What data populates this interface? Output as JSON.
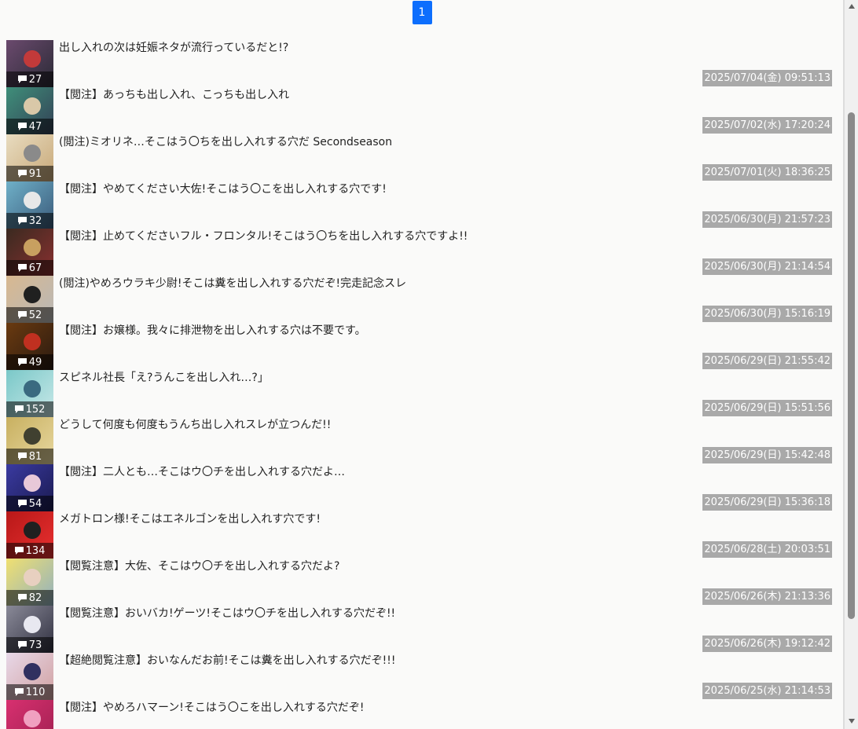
{
  "pagination": {
    "current_page": "1"
  },
  "threads": [
    {
      "title": "出し入れの次は妊娠ネタが流行っているだと!?",
      "count": "27",
      "date": "2025/07/04(金) 09:51:13",
      "colors": [
        "#6b4a6e",
        "#c23a3a",
        "#2a2a35"
      ]
    },
    {
      "title": "【閲注】あっちも出し入れ、こっちも出し入れ",
      "count": "47",
      "date": "2025/07/02(水) 17:20:24",
      "colors": [
        "#3f8f7a",
        "#d9c8a8",
        "#334055"
      ]
    },
    {
      "title": "(閲注)ミオリネ…そこはう〇ちを出し入れする穴だ Secondseason",
      "count": "91",
      "date": "2025/07/01(火) 18:36:25",
      "colors": [
        "#e8dcc0",
        "#8a8a8a",
        "#c8a878"
      ]
    },
    {
      "title": "【閲注】やめてください大佐!そこはう〇こを出し入れする穴です!",
      "count": "32",
      "date": "2025/06/30(月) 21:57:23",
      "colors": [
        "#6fb0c8",
        "#e8e8e8",
        "#3a5a7a"
      ]
    },
    {
      "title": "【閲注】止めてくださいフル・フロンタル!そこはう〇ちを出し入れする穴ですよ!!",
      "count": "67",
      "date": "2025/06/30(月) 21:14:54",
      "colors": [
        "#3a2a20",
        "#c8a060",
        "#8a3030"
      ]
    },
    {
      "title": "(閲注)やめろウラキ少尉!そこは糞を出し入れする穴だぞ!完走記念スレ",
      "count": "52",
      "date": "2025/06/30(月) 15:16:19",
      "colors": [
        "#d8b890",
        "#202020",
        "#b8b8b8"
      ]
    },
    {
      "title": "【閲注】お嬢様。我々に排泄物を出し入れする穴は不要です。",
      "count": "49",
      "date": "2025/06/29(日) 21:55:42",
      "colors": [
        "#6a3a10",
        "#c03020",
        "#2a1a10"
      ]
    },
    {
      "title": "スピネル社長「え?うんこを出し入れ…?」",
      "count": "152",
      "date": "2025/06/29(日) 15:51:56",
      "colors": [
        "#7ac8c8",
        "#3a6a80",
        "#c8e8e8"
      ]
    },
    {
      "title": "どうして何度も何度もうんち出し入れスレが立つんだ!!",
      "count": "81",
      "date": "2025/06/29(日) 15:42:48",
      "colors": [
        "#c8b060",
        "#404030",
        "#e8d8a0"
      ]
    },
    {
      "title": "【閲注】二人とも…そこはウ〇チを出し入れする穴だよ…",
      "count": "54",
      "date": "2025/06/29(日) 15:36:18",
      "colors": [
        "#3a3aa0",
        "#e8c8d8",
        "#1a1a50"
      ]
    },
    {
      "title": "メガトロン様!そこはエネルゴンを出し入れす穴です!",
      "count": "134",
      "date": "2025/06/28(土) 20:03:51",
      "colors": [
        "#b81818",
        "#202020",
        "#e83030"
      ]
    },
    {
      "title": "【閲覧注意】大佐、そこはウ〇チを出し入れする穴だよ?",
      "count": "82",
      "date": "2025/06/26(木) 21:13:36",
      "colors": [
        "#f0e070",
        "#e8d0c0",
        "#90b0c0"
      ]
    },
    {
      "title": "【閲覧注意】おいバカ!ゲーツ!そこはウ〇チを出し入れする穴だぞ!!",
      "count": "73",
      "date": "2025/06/26(木) 19:12:42",
      "colors": [
        "#8a8a98",
        "#e8e8f0",
        "#303040"
      ]
    },
    {
      "title": "【超絶閲覧注意】おいなんだお前!そこは糞を出し入れする穴だぞ!!!",
      "count": "110",
      "date": "2025/06/25(水) 21:14:53",
      "colors": [
        "#e8d8e8",
        "#303060",
        "#d0a0a0"
      ]
    },
    {
      "title": "【閲注】やめろハマーン!そこはう〇こを出し入れする穴だぞ!",
      "count": "",
      "date": "",
      "colors": [
        "#d83070",
        "#f0a0c0",
        "#a02050"
      ]
    }
  ],
  "icons": {
    "comment": "comment-icon",
    "scroll_up": "scroll-up-arrow-icon",
    "scroll_down": "scroll-down-arrow-icon"
  }
}
